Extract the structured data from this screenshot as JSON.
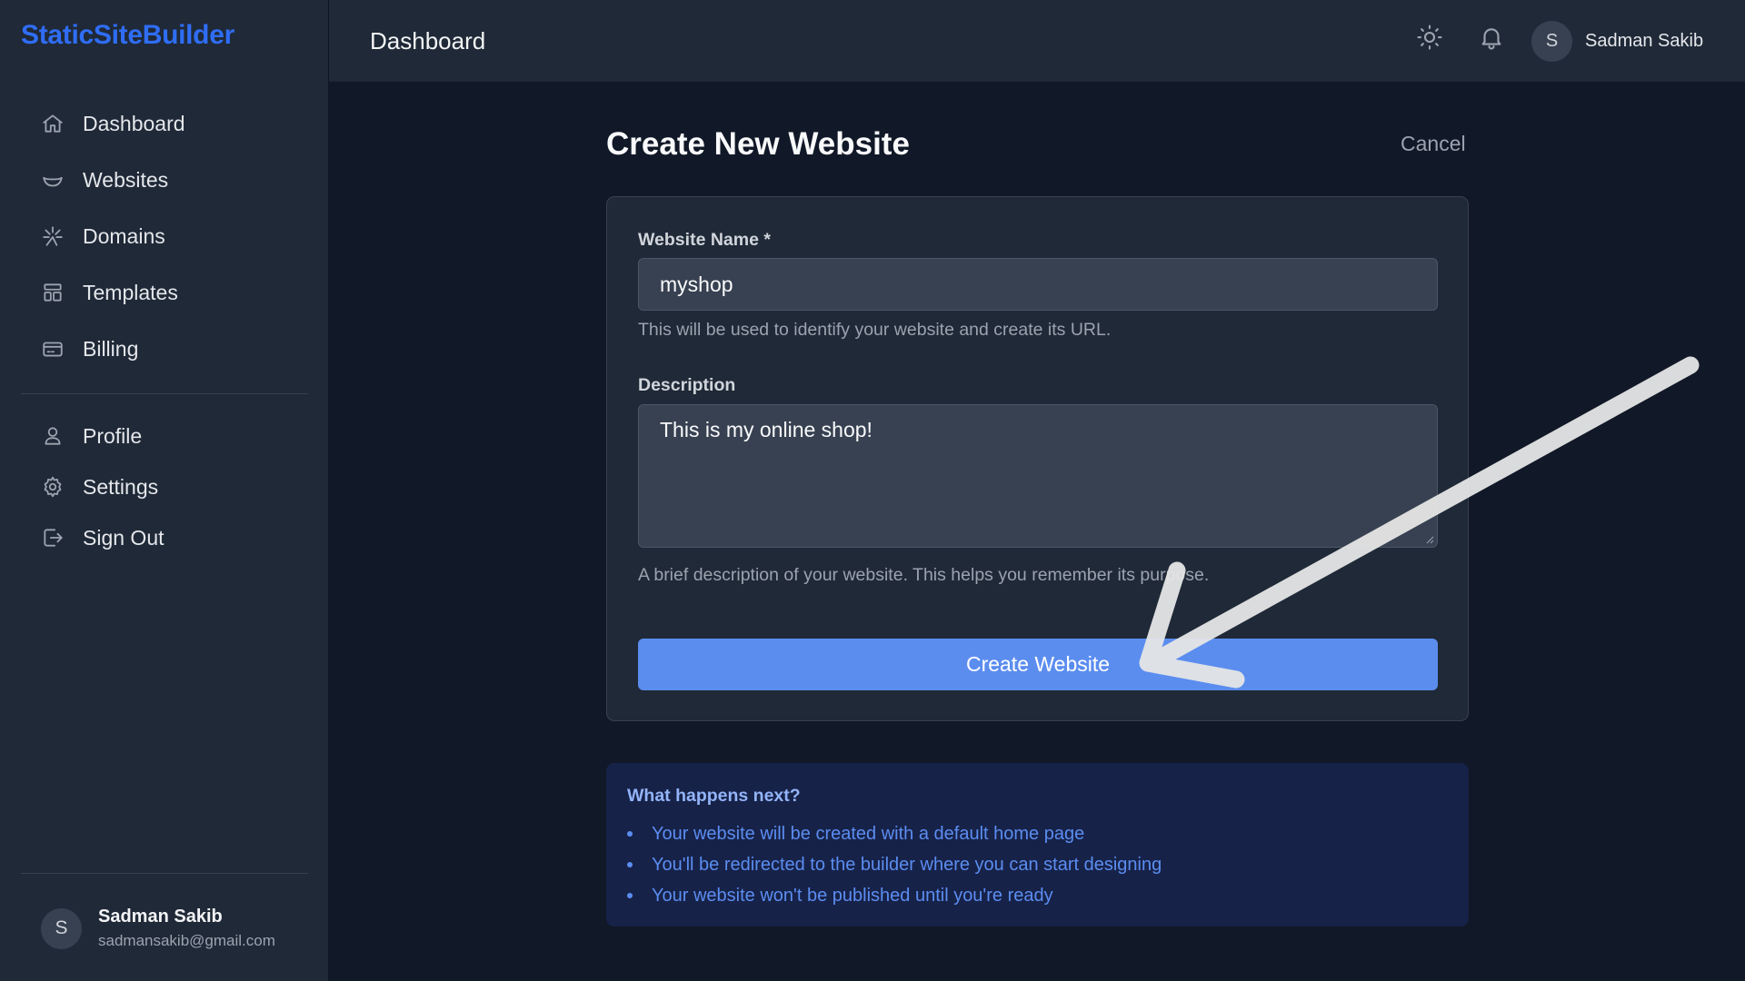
{
  "sidebar": {
    "brand": "StaticSiteBuilder",
    "items": [
      {
        "label": "Dashboard",
        "icon": "home-icon"
      },
      {
        "label": "Websites",
        "icon": "websites-icon"
      },
      {
        "label": "Domains",
        "icon": "domains-icon"
      },
      {
        "label": "Templates",
        "icon": "templates-icon"
      },
      {
        "label": "Billing",
        "icon": "credit-card-icon"
      }
    ],
    "secondary_items": [
      {
        "label": "Profile",
        "icon": "user-icon"
      },
      {
        "label": "Settings",
        "icon": "gear-icon"
      },
      {
        "label": "Sign Out",
        "icon": "sign-out-icon"
      }
    ],
    "user": {
      "initial": "S",
      "name": "Sadman Sakib",
      "email": "sadmansakib@gmail.com"
    }
  },
  "header": {
    "title": "Dashboard",
    "user_initial": "S",
    "user_name": "Sadman Sakib"
  },
  "main": {
    "title": "Create New Website",
    "cancel_label": "Cancel",
    "form": {
      "name_label": "Website Name *",
      "name_value": "myshop",
      "name_hint": "This will be used to identify your website and create its URL.",
      "description_label": "Description",
      "description_value": "This is my online shop!",
      "description_hint": "A brief description of your website. This helps you remember its purpose.",
      "submit_label": "Create Website"
    },
    "next": {
      "title": "What happens next?",
      "items": [
        "Your website will be created with a default home page",
        "You'll be redirected to the builder where you can start designing",
        "Your website won't be published until you're ready"
      ]
    }
  },
  "colors": {
    "brand": "#2f6df5",
    "primary_button": "#5b8def",
    "info_text": "#5b8df0"
  }
}
